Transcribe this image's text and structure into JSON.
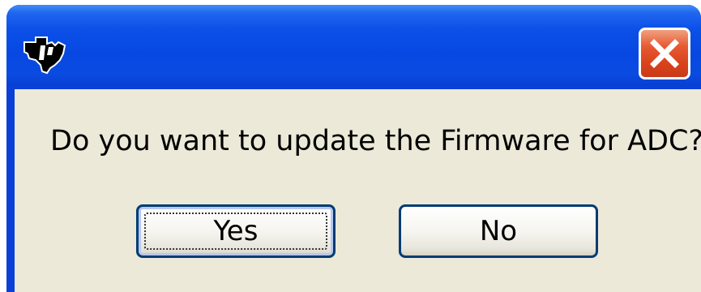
{
  "dialog": {
    "message": "Do you want to update the Firmware for ADC?",
    "buttons": {
      "yes_label": "Yes",
      "no_label": "No"
    },
    "close_icon": "close-icon",
    "app_icon": "texas-instruments-logo-icon"
  },
  "colors": {
    "titlebar": "#0748e2",
    "client_bg": "#ece9d8",
    "close_button": "#d9431c",
    "button_border": "#003c74"
  }
}
